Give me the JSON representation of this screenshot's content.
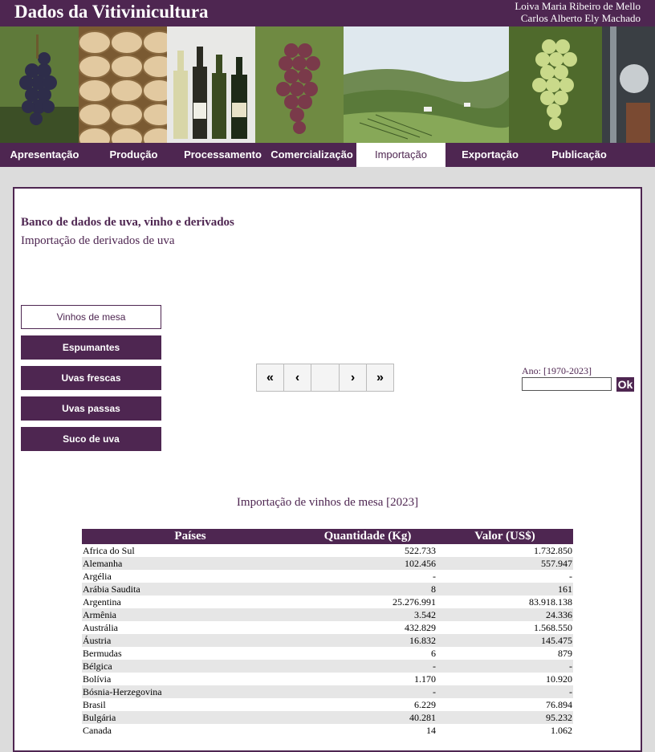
{
  "header": {
    "title": "Dados da Vitivinicultura",
    "authors": [
      "Loiva Maria Ribeiro de Mello",
      "Carlos Alberto Ely Machado"
    ]
  },
  "nav": [
    {
      "label": "Apresentação"
    },
    {
      "label": "Produção"
    },
    {
      "label": "Processamento"
    },
    {
      "label": "Comercialização"
    },
    {
      "label": "Importação",
      "active": true
    },
    {
      "label": "Exportação"
    },
    {
      "label": "Publicação"
    }
  ],
  "main": {
    "db_title": "Banco de dados de uva, vinho e derivados",
    "db_subtitle": "Importação de derivados de uva",
    "sub_options": [
      {
        "label": "Vinhos de mesa",
        "active": true
      },
      {
        "label": "Espumantes"
      },
      {
        "label": "Uvas frescas"
      },
      {
        "label": "Uvas passas"
      },
      {
        "label": "Suco de uva"
      }
    ],
    "pager": {
      "first": "«",
      "prev": "‹",
      "page": "",
      "next": "›",
      "last": "»"
    },
    "year": {
      "label": "Ano: [1970-2023]",
      "value": "",
      "ok": "Ok"
    },
    "table": {
      "caption": "Importação de vinhos de mesa [2023]",
      "headers": [
        "Países",
        "Quantidade (Kg)",
        "Valor (US$)"
      ],
      "rows": [
        [
          "Africa do Sul",
          "522.733",
          "1.732.850"
        ],
        [
          "Alemanha",
          "102.456",
          "557.947"
        ],
        [
          "Argélia",
          "-",
          "-"
        ],
        [
          "Arábia Saudita",
          "8",
          "161"
        ],
        [
          "Argentina",
          "25.276.991",
          "83.918.138"
        ],
        [
          "Armênia",
          "3.542",
          "24.336"
        ],
        [
          "Austrália",
          "432.829",
          "1.568.550"
        ],
        [
          "Áustria",
          "16.832",
          "145.475"
        ],
        [
          "Bermudas",
          "6",
          "879"
        ],
        [
          "Bélgica",
          "-",
          "-"
        ],
        [
          "Bolívia",
          "1.170",
          "10.920"
        ],
        [
          "Bósnia-Herzegovina",
          "-",
          "-"
        ],
        [
          "Brasil",
          "6.229",
          "76.894"
        ],
        [
          "Bulgária",
          "40.281",
          "95.232"
        ],
        [
          "Canada",
          "14",
          "1.062"
        ]
      ]
    }
  }
}
